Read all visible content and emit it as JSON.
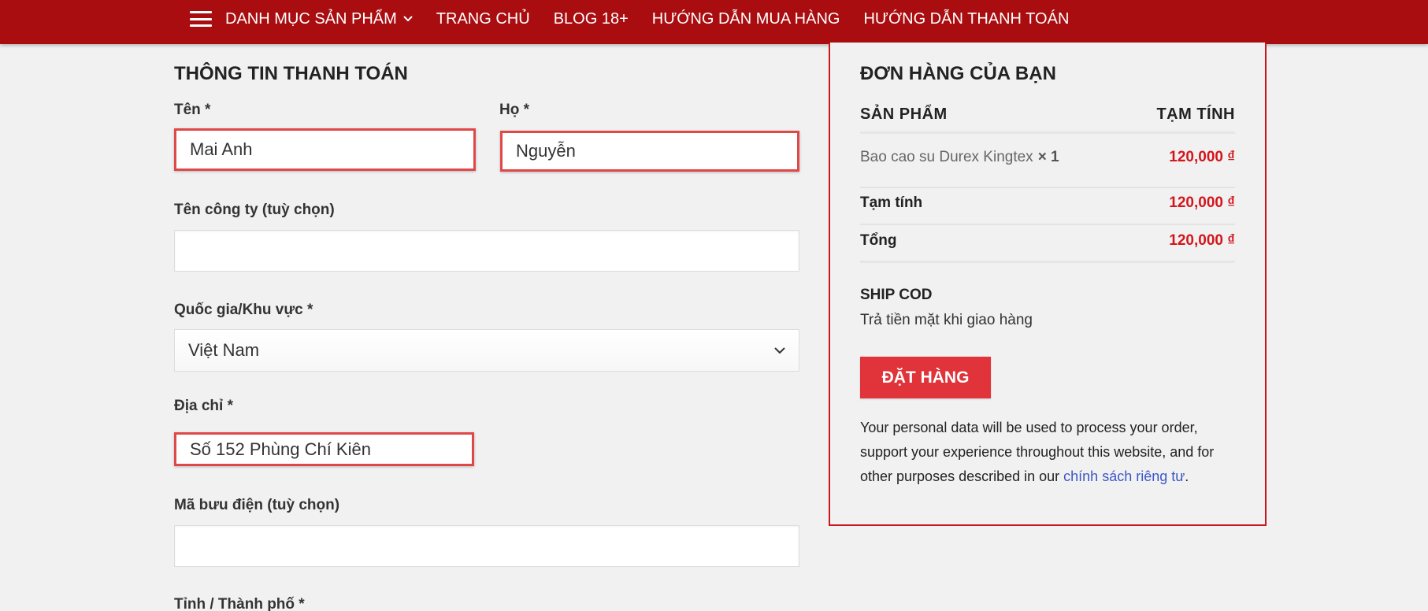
{
  "nav": {
    "menu_label": "DANH MỤC SẢN PHẨM",
    "items": [
      "TRANG CHỦ",
      "BLOG 18+",
      "HƯỚNG DẪN MUA HÀNG",
      "HƯỚNG DẪN THANH TOÁN"
    ]
  },
  "billing": {
    "title": "THÔNG TIN THANH TOÁN",
    "first_name_label": "Tên *",
    "first_name_value": "Mai Anh",
    "last_name_label": "Họ *",
    "last_name_value": "Nguyễn",
    "company_label": "Tên công ty (tuỳ chọn)",
    "company_value": "",
    "country_label": "Quốc gia/Khu vực *",
    "country_value": "Việt Nam",
    "address_label": "Địa chỉ *",
    "address_value": "Số 152 Phùng Chí Kiên",
    "postcode_label": "Mã bưu điện (tuỳ chọn)",
    "postcode_value": "",
    "city_label": "Tỉnh / Thành phố *"
  },
  "order": {
    "title": "ĐƠN HÀNG CỦA BẠN",
    "col_product": "SẢN PHẨM",
    "col_subtotal": "TẠM TÍNH",
    "product_name": "Bao cao su Durex Kingtex",
    "product_qty": "× 1",
    "product_price": "120,000 ₫",
    "subtotal_label": "Tạm tính",
    "subtotal_value": "120,000 ₫",
    "total_label": "Tổng",
    "total_value": "120,000 ₫",
    "shipping_title": "SHIP COD",
    "shipping_desc": "Trả tiền mặt khi giao hàng",
    "place_order_label": "ĐẶT HÀNG",
    "privacy_text": "Your personal data will be used to process your order, support your experience throughout this website, and for other purposes described in our ",
    "privacy_link": "chính sách riêng tư",
    "privacy_end": "."
  },
  "colors": {
    "nav_bg": "#a90d10",
    "accent_red": "#d3161c",
    "button_red": "#e0333a",
    "highlight_border": "#e04848",
    "link_blue": "#3c56c7"
  }
}
